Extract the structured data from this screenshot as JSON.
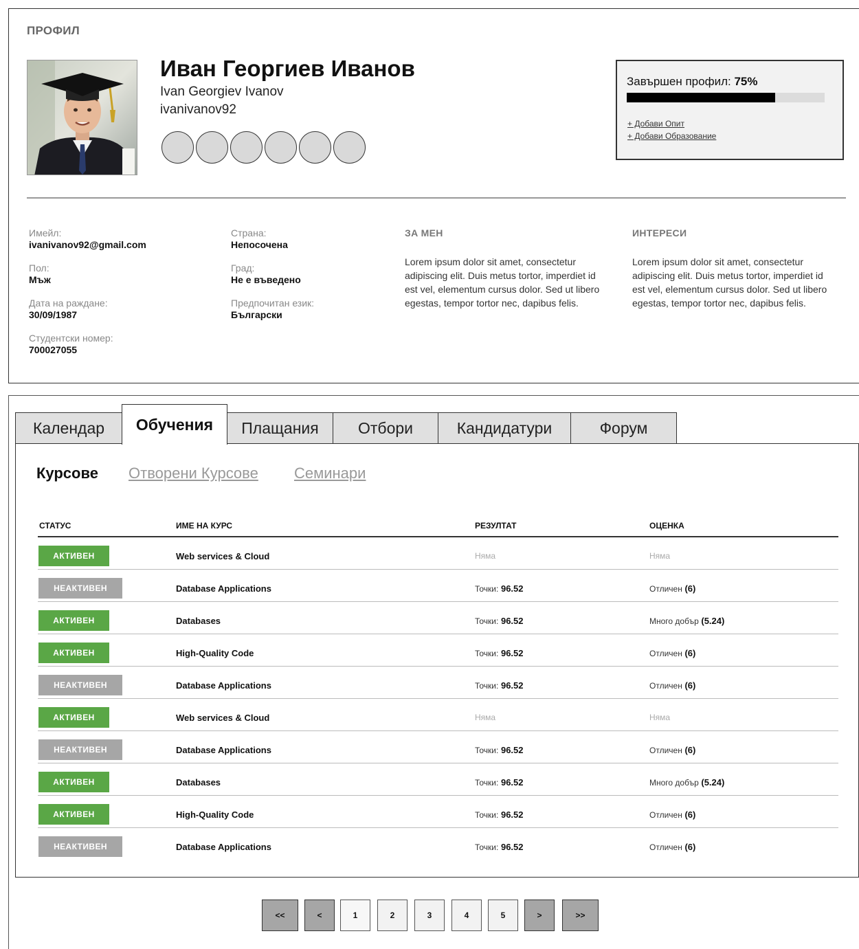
{
  "profile": {
    "heading": "ПРОФИЛ",
    "name": "Иван Георгиев Иванов",
    "name_latin": "Ivan Georgiev Ivanov",
    "username": "ivanivanov92",
    "badge_count": 6,
    "completion": {
      "label": "Завършен профил:",
      "percent_text": "75%",
      "percent": 75,
      "links": [
        "+ Добави Опит",
        "+ Добави Образование"
      ]
    },
    "info_left": [
      {
        "label": "Имейл:",
        "value": "ivanivanov92@gmail.com"
      },
      {
        "label": "Пол:",
        "value": "Мъж"
      },
      {
        "label": "Дата на раждане:",
        "value": "30/09/1987"
      },
      {
        "label": "Студентски номер:",
        "value": "700027055"
      }
    ],
    "info_mid": [
      {
        "label": "Страна:",
        "value": "Непосочена"
      },
      {
        "label": "Град:",
        "value": "Не е въведено"
      },
      {
        "label": "Предпочитан език:",
        "value": "Български"
      }
    ],
    "about": {
      "title": "ЗА МЕН",
      "text": "Lorem ipsum dolor sit amet, consectetur adipiscing elit. Duis metus tortor, imperdiet id est vel, elementum cursus dolor. Sed ut libero egestas, tempor tortor nec, dapibus felis."
    },
    "interests": {
      "title": "ИНТЕРЕСИ",
      "text": "Lorem ipsum dolor sit amet, consectetur adipiscing elit. Duis metus tortor, imperdiet id est vel, elementum cursus dolor. Sed ut libero egestas, tempor tortor nec, dapibus felis."
    }
  },
  "tabs": [
    "Календар",
    "Обучения",
    "Плащания",
    "Отбори",
    "Кандидатури",
    "Форум"
  ],
  "active_tab": 1,
  "subtabs": [
    "Курсове",
    "Отворени Курсове",
    "Семинари"
  ],
  "table": {
    "headers": [
      "СТАТУС",
      "ИМЕ НА КУРС",
      "РЕЗУЛТАТ",
      "ОЦЕНКА"
    ],
    "rows": [
      {
        "status": "АКТИВЕН",
        "active": true,
        "course": "Web services & Cloud",
        "result_label": "Няма",
        "result_value": "",
        "grade_text": "Няма",
        "grade_value": ""
      },
      {
        "status": "НЕАКТИВЕН",
        "active": false,
        "course": "Database Applications",
        "result_label": "Точки:",
        "result_value": "96.52",
        "grade_text": "Отличен",
        "grade_value": "(6)"
      },
      {
        "status": "АКТИВЕН",
        "active": true,
        "course": "Databases",
        "result_label": "Точки:",
        "result_value": "96.52",
        "grade_text": "Много добър",
        "grade_value": "(5.24)"
      },
      {
        "status": "АКТИВЕН",
        "active": true,
        "course": "High-Quality Code",
        "result_label": "Точки:",
        "result_value": "96.52",
        "grade_text": "Отличен",
        "grade_value": "(6)"
      },
      {
        "status": "НЕАКТИВЕН",
        "active": false,
        "course": "Database Applications",
        "result_label": "Точки:",
        "result_value": "96.52",
        "grade_text": "Отличен",
        "grade_value": "(6)"
      },
      {
        "status": "АКТИВЕН",
        "active": true,
        "course": "Web services & Cloud",
        "result_label": "Няма",
        "result_value": "",
        "grade_text": "Няма",
        "grade_value": ""
      },
      {
        "status": "НЕАКТИВЕН",
        "active": false,
        "course": "Database Applications",
        "result_label": "Точки:",
        "result_value": "96.52",
        "grade_text": "Отличен",
        "grade_value": "(6)"
      },
      {
        "status": "АКТИВЕН",
        "active": true,
        "course": "Databases",
        "result_label": "Точки:",
        "result_value": "96.52",
        "grade_text": "Много добър",
        "grade_value": "(5.24)"
      },
      {
        "status": "АКТИВЕН",
        "active": true,
        "course": "High-Quality Code",
        "result_label": "Точки:",
        "result_value": "96.52",
        "grade_text": "Отличен",
        "grade_value": "(6)"
      },
      {
        "status": "НЕАКТИВЕН",
        "active": false,
        "course": "Database Applications",
        "result_label": "Точки:",
        "result_value": "96.52",
        "grade_text": "Отличен",
        "grade_value": "(6)"
      }
    ]
  },
  "pagination": [
    "<<",
    "<",
    "1",
    "2",
    "3",
    "4",
    "5",
    ">",
    ">>"
  ],
  "current_page": "1",
  "colors": {
    "active_status": "#5aa746",
    "inactive_status": "#a6a6a6"
  }
}
